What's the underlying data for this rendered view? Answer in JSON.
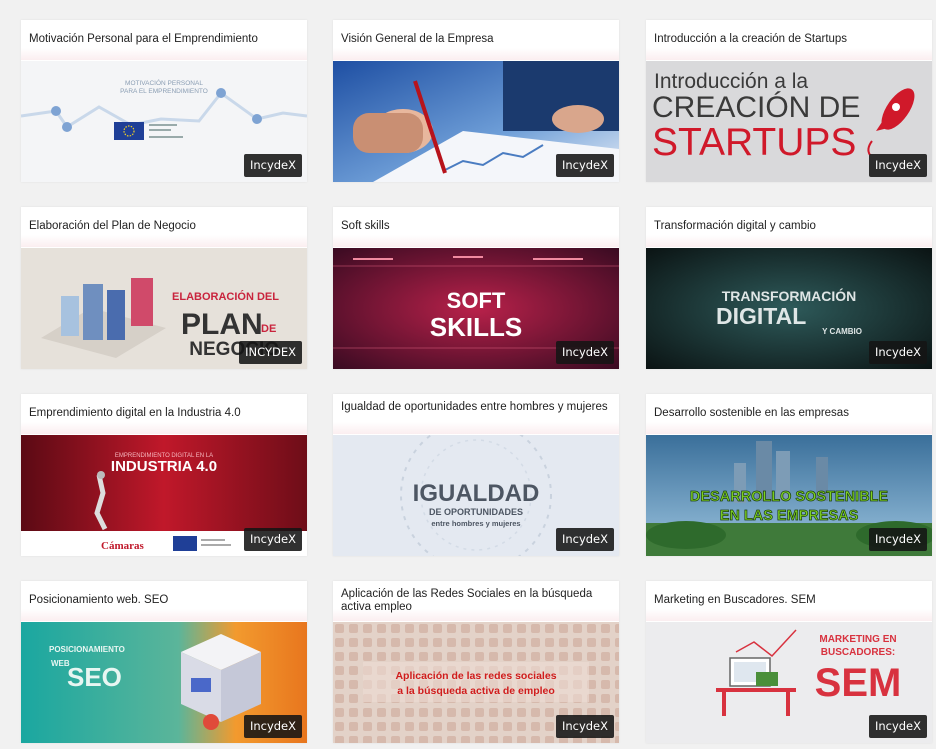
{
  "courses": [
    {
      "title": "Motivación Personal para el Emprendimiento",
      "badge": "IncydeX",
      "thumb_lines": [
        "MOTIVACIÓN PERSONAL",
        "PARA EL EMPRENDIMIENTO"
      ]
    },
    {
      "title": "Visión General de la Empresa",
      "badge": "IncydeX",
      "thumb_lines": []
    },
    {
      "title": "Introducción a la creación de Startups",
      "badge": "IncydeX",
      "thumb_lines": [
        "Introducción a la",
        "CREACIÓN DE",
        "STARTUPS"
      ]
    },
    {
      "title": "Elaboración del Plan de Negocio",
      "badge": "INCYDEX",
      "thumb_lines": [
        "ELABORACIÓN DEL",
        "PLAN",
        "DE",
        "NEGOCIO"
      ]
    },
    {
      "title": "Soft skills",
      "badge": "IncydeX",
      "thumb_lines": [
        "SOFT",
        "SKILLS"
      ]
    },
    {
      "title": "Transformación digital y cambio",
      "badge": "IncydeX",
      "thumb_lines": [
        "TRANSFORMACIÓN",
        "DIGITAL",
        "Y CAMBIO"
      ]
    },
    {
      "title": "Emprendimiento digital en la Industria 4.0",
      "badge": "IncydeX",
      "thumb_lines": [
        "EMPRENDIMIENTO DIGITAL EN LA",
        "INDUSTRIA 4.0",
        "Cámaras"
      ]
    },
    {
      "title": "Igualdad de oportunidades entre hombres y mujeres",
      "badge": "IncydeX",
      "thumb_lines": [
        "IGUALDAD",
        "DE OPORTUNIDADES",
        "entre hombres y mujeres"
      ]
    },
    {
      "title": "Desarrollo sostenible en las empresas",
      "badge": "IncydeX",
      "thumb_lines": [
        "DESARROLLO SOSTENIBLE",
        "EN LAS EMPRESAS"
      ]
    },
    {
      "title": "Posicionamiento web. SEO",
      "badge": "IncydeX",
      "thumb_lines": [
        "POSICIONAMIENTO",
        "WEB",
        "SEO"
      ]
    },
    {
      "title": "Aplicación de las Redes Sociales en la búsqueda activa empleo",
      "badge": "IncydeX",
      "thumb_lines": [
        "Aplicación de las redes sociales",
        "a la búsqueda activa de empleo"
      ]
    },
    {
      "title": "Marketing en Buscadores. SEM",
      "badge": "IncydeX",
      "thumb_lines": [
        "MARKETING EN",
        "BUSCADORES:",
        "SEM"
      ]
    }
  ]
}
